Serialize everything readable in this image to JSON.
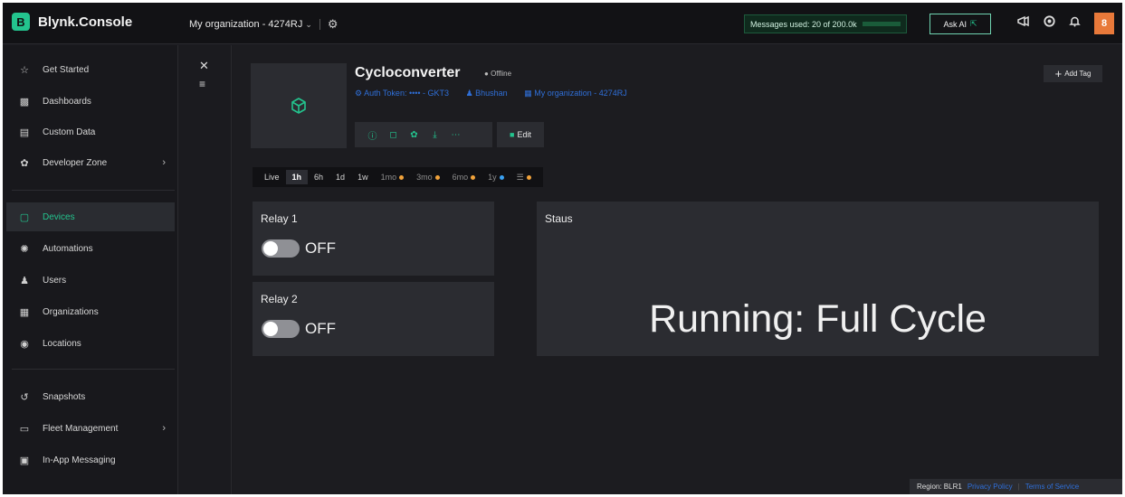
{
  "brand": {
    "logo_letter": "B",
    "name": "Blynk.Console"
  },
  "topbar": {
    "org_label": "My organization - 4274RJ",
    "messages_used": "Messages used: 20 of 200.0k",
    "messages_fraction": 0.0001,
    "ask_ai": "Ask AI",
    "avatar_letter": "8",
    "icons": [
      "chevron-down-icon",
      "gear-icon",
      "megaphone-icon",
      "help-circle-icon",
      "bell-icon",
      "user-avatar"
    ]
  },
  "sidebar": {
    "items": [
      {
        "label": "Get Started",
        "icon": "star-icon"
      },
      {
        "label": "Dashboards",
        "icon": "chart-icon"
      },
      {
        "label": "Custom Data",
        "icon": "database-icon"
      },
      {
        "label": "Developer Zone",
        "icon": "dev-icon"
      },
      {
        "label": "Devices",
        "icon": "cube-icon"
      },
      {
        "label": "Automations",
        "icon": "automation-icon"
      },
      {
        "label": "Users",
        "icon": "users-icon"
      },
      {
        "label": "Organizations",
        "icon": "building-icon"
      },
      {
        "label": "Locations",
        "icon": "pin-icon"
      },
      {
        "label": "Snapshots",
        "icon": "snapshot-icon"
      },
      {
        "label": "Fleet Management",
        "icon": "fleet-icon"
      },
      {
        "label": "In-App Messaging",
        "icon": "message-icon"
      }
    ],
    "active": "Devices"
  },
  "device": {
    "name": "Cycloconverter",
    "status": "Offline",
    "auth_token": "Auth Token: •••• - GKT3",
    "owner": "Bhushan",
    "organization": "My organization - 4274RJ",
    "edit_label": "Edit",
    "add_tag_label": "Add Tag"
  },
  "time_ranges": [
    {
      "label": "Live"
    },
    {
      "label": "1h"
    },
    {
      "label": "6h"
    },
    {
      "label": "1d"
    },
    {
      "label": "1w"
    },
    {
      "label": "1mo"
    },
    {
      "label": "3mo"
    },
    {
      "label": "6mo"
    },
    {
      "label": "1y"
    }
  ],
  "selected_range": "1h",
  "widgets": {
    "relay1": {
      "title": "Relay 1",
      "state": "OFF"
    },
    "relay2": {
      "title": "Relay 2",
      "state": "OFF"
    },
    "status": {
      "title": "Staus",
      "value": "Running: Full Cycle"
    }
  },
  "footer": {
    "region": "Region: BLR1",
    "privacy": "Privacy Policy",
    "terms": "Terms of Service"
  },
  "colors": {
    "accent": "#23c48e",
    "background": "#1c1c20",
    "tile": "#2b2c31",
    "link": "#2f6fd8",
    "avatar": "#e8793a"
  }
}
